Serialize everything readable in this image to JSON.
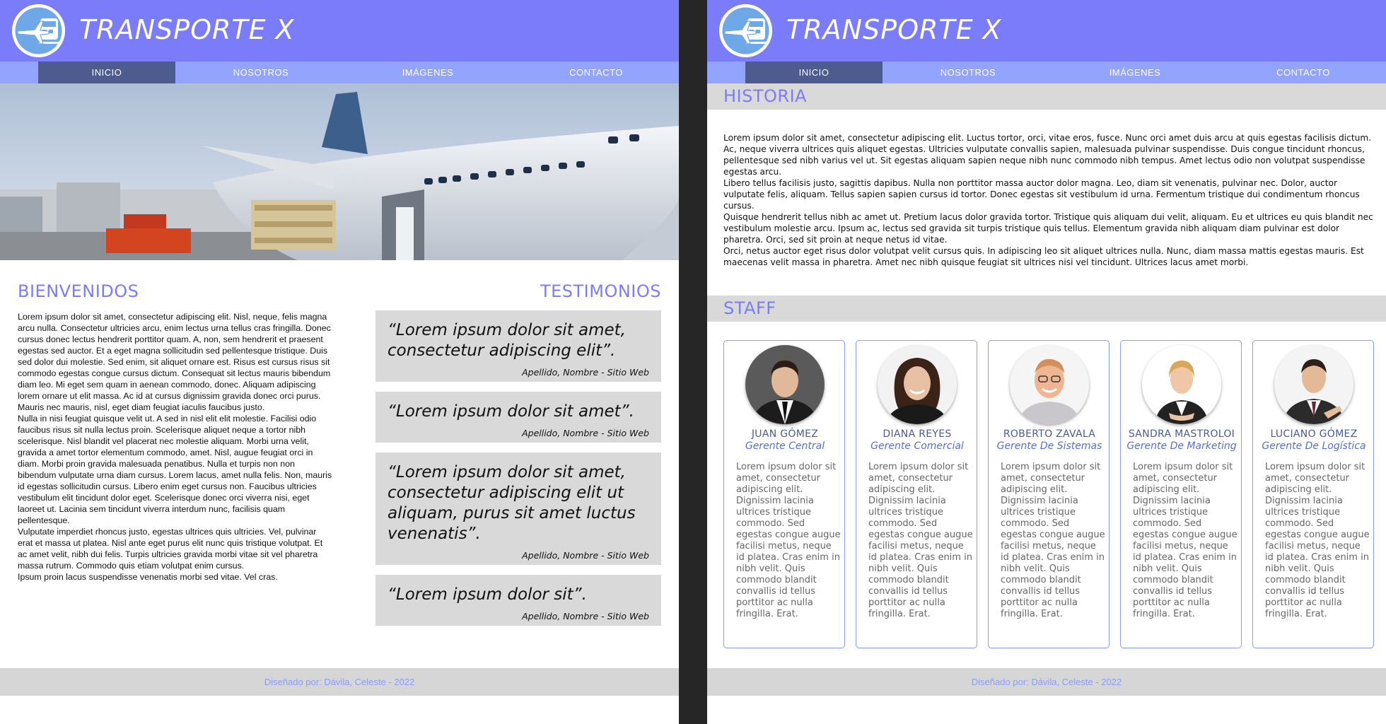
{
  "site": {
    "brand": "TRANSPORTE X",
    "nav": [
      "INICIO",
      "NOSOTROS",
      "IMÁGENES",
      "CONTACTO"
    ],
    "active_nav": "INICIO",
    "footer": "Diseñado por: Dávila, Celeste - 2022"
  },
  "home": {
    "bienvenidos_title": "BIENVENIDOS",
    "testimonios_title": "TESTIMONIOS",
    "bienvenidos_paragraphs": [
      "Lorem ipsum dolor sit amet, consectetur adipiscing elit. Nisl, neque, felis magna arcu nulla. Consectetur ultricies arcu, enim lectus urna tellus cras fringilla. Donec cursus donec lectus hendrerit porttitor quam. A, non, sem hendrerit et praesent egestas sed auctor. Et a eget magna sollicitudin sed pellentesque tristique. Duis sed dolor dui molestie. Sed enim, sit aliquet ornare est. Risus est cursus risus sit commodo egestas congue cursus dictum. Consequat sit lectus mauris bibendum diam leo. Mi eget sem quam in aenean commodo, donec. Aliquam adipiscing lorem ornare ut elit massa. Ac id at cursus dignissim gravida donec orci purus. Mauris nec mauris, nisl, eget diam feugiat iaculis faucibus justo.",
      "Nulla in nisi feugiat quisque velit ut. A sed in nisl elit elit molestie. Facilisi odio faucibus risus sit nulla lectus proin. Scelerisque aliquet neque a tortor nibh scelerisque. Nisl blandit vel placerat nec molestie aliquam. Morbi urna velit, gravida a amet tortor elementum commodo, amet. Nisl, augue feugiat orci in diam. Morbi proin gravida malesuada penatibus. Nulla et turpis non non bibendum vulputate urna diam cursus. Lorem lacus, amet nulla felis. Non, mauris id egestas sollicitudin cursus. Libero enim eget cursus non. Faucibus ultricies vestibulum elit tincidunt dolor eget. Scelerisque donec orci viverra nisi, eget laoreet ut. Lacinia sem tincidunt viverra interdum nunc, facilisis quam pellentesque.",
      "Vulputate imperdiet rhoncus justo, egestas ultrices quis ultricies. Vel, pulvinar erat et massa ut platea. Nisl ante eget purus elit nunc quis tristique volutpat. Et ac amet velit, nibh dui felis. Turpis ultricies gravida morbi vitae sit vel pharetra massa rutrum. Commodo quis etiam volutpat enim cursus.",
      "Ipsum proin lacus suspendisse venenatis morbi sed vitae. Vel cras."
    ],
    "testimonials": [
      {
        "quote": "“Lorem ipsum dolor sit amet, consectetur adipiscing elit”.",
        "cite": "Apellido, Nombre - Sitio Web"
      },
      {
        "quote": "“Lorem ipsum dolor sit amet”.",
        "cite": "Apellido, Nombre - Sitio Web"
      },
      {
        "quote": "“Lorem ipsum dolor sit amet, consectetur adipiscing elit ut aliquam, purus sit amet luctus venenatis”.",
        "cite": "Apellido, Nombre - Sitio Web"
      },
      {
        "quote": "“Lorem ipsum dolor sit”.",
        "cite": "Apellido, Nombre - Sitio Web"
      }
    ]
  },
  "about": {
    "historia_title": "HISTORIA",
    "historia_paragraphs": [
      "Lorem ipsum dolor sit amet, consectetur adipiscing elit. Luctus tortor, orci, vitae eros, fusce. Nunc orci amet duis arcu at quis egestas facilisis dictum. Ac, neque viverra ultrices quis aliquet egestas. Ultricies vulputate convallis sapien, malesuada pulvinar suspendisse. Duis congue tincidunt rhoncus, pellentesque sed nibh varius vel ut. Sit egestas aliquam sapien neque nibh nunc commodo nibh tempus. Amet lectus odio non volutpat suspendisse egestas arcu.",
      "Libero tellus facilisis justo, sagittis dapibus. Nulla non porttitor massa auctor dolor magna. Leo, diam sit venenatis, pulvinar nec. Dolor, auctor vulputate felis, aliquam. Tellus sapien sapien cursus id tortor. Donec egestas sit vestibulum id urna. Fermentum tristique dui condimentum rhoncus cursus.",
      "Quisque hendrerit tellus nibh ac amet ut. Pretium lacus dolor gravida tortor. Tristique quis aliquam dui velit, aliquam. Eu et ultrices eu quis blandit nec vestibulum molestie arcu. Ipsum ac, lectus sed gravida sit turpis tristique quis tellus. Elementum gravida nibh aliquam diam pulvinar est dolor pharetra. Orci, sed sit proin at neque netus id vitae.",
      "Orci, netus auctor eget risus dolor volutpat velit cursus quis. In adipiscing leo sit aliquet ultrices nulla. Nunc, diam massa mattis egestas mauris. Est maecenas velit massa in pharetra. Amet nec nibh quisque feugiat sit ultrices nisi vel tincidunt. Ultrices lacus amet morbi."
    ],
    "staff_title": "STAFF",
    "staff_bio": "Lorem ipsum dolor sit amet, consectetur adipiscing elit. Dignissim lacinia ultrices tristique commodo. Sed egestas congue augue facilisi metus, neque id platea. Cras enim in nibh velit. Quis commodo blandit convallis id tellus porttitor ac nulla fringilla. Erat.",
    "staff": [
      {
        "name": "JUAN GÓMEZ",
        "role": "Gerente Central"
      },
      {
        "name": "DIANA REYES",
        "role": "Gerente Comercial"
      },
      {
        "name": "ROBERTO ZAVALA",
        "role": "Gerente De Sistemas"
      },
      {
        "name": "SANDRA MASTROLOI",
        "role": "Gerente De Marketing"
      },
      {
        "name": "LUCIANO GÓMEZ",
        "role": "Gerente De Logística"
      }
    ]
  },
  "colors": {
    "header": "#7b7cf9",
    "nav": "#92a4ff",
    "nav_active": "#4d5b8f",
    "accent_text": "#7b7cf9",
    "card_border": "#8a9cff",
    "band": "#d9d9d9"
  }
}
